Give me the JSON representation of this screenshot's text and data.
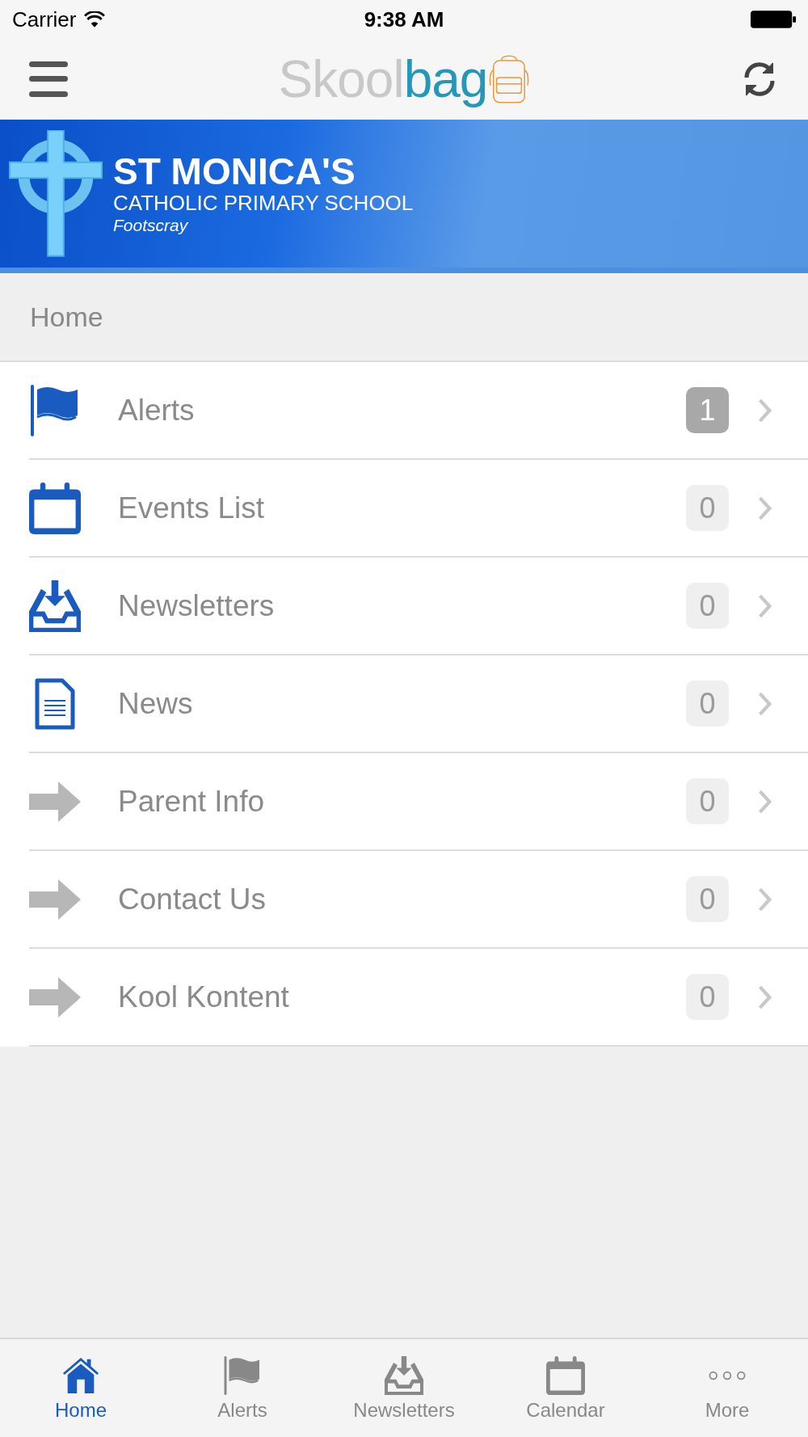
{
  "status_bar": {
    "carrier": "Carrier",
    "time": "9:38 AM"
  },
  "nav_bar": {
    "logo": {
      "text_1": "Skool",
      "text_2": "bag"
    }
  },
  "banner": {
    "school_name": "ST MONICA'S",
    "school_type": "CATHOLIC PRIMARY SCHOOL",
    "suburb": "Footscray"
  },
  "section": {
    "title": "Home"
  },
  "menu_items": [
    {
      "label": "Alerts",
      "kind": "flag",
      "count": "1",
      "unread": true
    },
    {
      "label": "Events List",
      "kind": "calendar",
      "count": "0",
      "unread": false
    },
    {
      "label": "Newsletters",
      "kind": "inbox",
      "count": "0",
      "unread": false
    },
    {
      "label": "News",
      "kind": "document",
      "count": "0",
      "unread": false
    },
    {
      "label": "Parent Info",
      "kind": "arrow",
      "count": "0",
      "unread": false
    },
    {
      "label": "Contact Us",
      "kind": "arrow",
      "count": "0",
      "unread": false
    },
    {
      "label": "Kool Kontent",
      "kind": "arrow",
      "count": "0",
      "unread": false
    }
  ],
  "tab_bar": [
    {
      "label": "Home",
      "kind": "home",
      "selected": true
    },
    {
      "label": "Alerts",
      "kind": "flag",
      "selected": false
    },
    {
      "label": "Newsletters",
      "kind": "inbox",
      "selected": false
    },
    {
      "label": "Calendar",
      "kind": "calendar",
      "selected": false
    },
    {
      "label": "More",
      "kind": "more",
      "selected": false
    }
  ]
}
